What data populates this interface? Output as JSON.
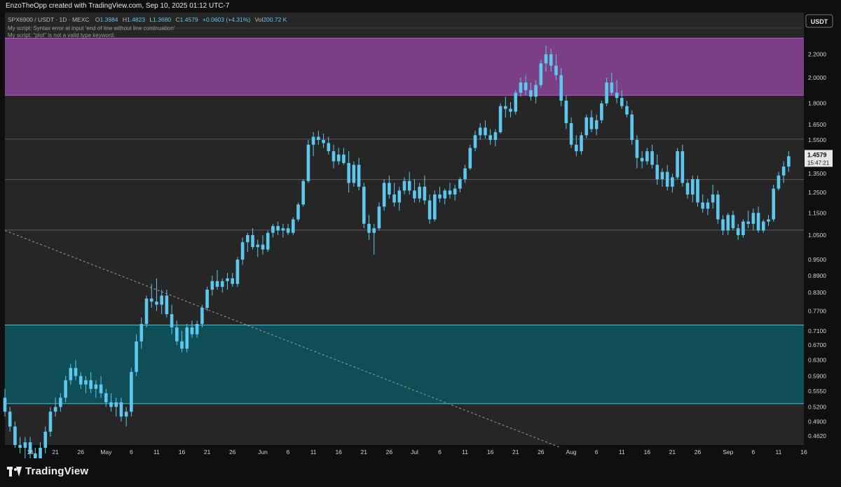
{
  "header": {
    "byline": "EnzoTheOpp created with TradingView.com, Sep 10, 2025 01:12 UTC-7"
  },
  "legend": {
    "symbol": "SPX6900 / USDT · 1D · MEXC",
    "open_label": "O",
    "open": "1.3984",
    "high_label": "H",
    "high": "1.4823",
    "low_label": "L",
    "low": "1.3680",
    "close_label": "C",
    "close": "1.4579",
    "change": "+0.0603 (+4.31%)",
    "vol_label": "Vol",
    "volume": "200.72 K",
    "error1": "My script: Syntax error at input 'end of line without line continuation'",
    "error2": "My script: \"plot\" is not a valid type keyword."
  },
  "footer": {
    "brand": "TradingView"
  },
  "colors": {
    "candle": "#5dc8ee",
    "supply_zone": "#7a3f85",
    "demand_zone": "#0f4d57",
    "grid_line": "#5a5a5a",
    "background": "#262626",
    "axis_bg": "#0f0f0f"
  },
  "chart_data": {
    "type": "candlestick",
    "currency": "USDT",
    "y_scale": "log",
    "ylim": [
      0.445,
      2.45
    ],
    "xlim": [
      "2025-04-11",
      "2025-09-16"
    ],
    "y_ticks": [
      "2.2000",
      "2.0000",
      "1.8000",
      "1.6500",
      "1.5500",
      "1.4500",
      "1.3500",
      "1.2500",
      "1.1500",
      "1.0500",
      "0.9500",
      "0.8900",
      "0.8300",
      "0.7700",
      "0.7100",
      "0.6700",
      "0.6300",
      "0.5900",
      "0.5550",
      "0.5200",
      "0.4900",
      "0.4620"
    ],
    "x_ticks": [
      {
        "date": "2025-04-16",
        "label": "16"
      },
      {
        "date": "2025-04-21",
        "label": "21"
      },
      {
        "date": "2025-04-26",
        "label": "26"
      },
      {
        "date": "2025-05-01",
        "label": "May"
      },
      {
        "date": "2025-05-06",
        "label": "6"
      },
      {
        "date": "2025-05-11",
        "label": "11"
      },
      {
        "date": "2025-05-16",
        "label": "16"
      },
      {
        "date": "2025-05-21",
        "label": "21"
      },
      {
        "date": "2025-05-26",
        "label": "26"
      },
      {
        "date": "2025-06-01",
        "label": "Jun"
      },
      {
        "date": "2025-06-06",
        "label": "6"
      },
      {
        "date": "2025-06-11",
        "label": "11"
      },
      {
        "date": "2025-06-16",
        "label": "16"
      },
      {
        "date": "2025-06-21",
        "label": "21"
      },
      {
        "date": "2025-06-26",
        "label": "26"
      },
      {
        "date": "2025-07-01",
        "label": "Jul"
      },
      {
        "date": "2025-07-06",
        "label": "6"
      },
      {
        "date": "2025-07-11",
        "label": "11"
      },
      {
        "date": "2025-07-16",
        "label": "16"
      },
      {
        "date": "2025-07-21",
        "label": "21"
      },
      {
        "date": "2025-07-26",
        "label": "26"
      },
      {
        "date": "2025-08-01",
        "label": "Aug"
      },
      {
        "date": "2025-08-06",
        "label": "6"
      },
      {
        "date": "2025-08-11",
        "label": "11"
      },
      {
        "date": "2025-08-16",
        "label": "16"
      },
      {
        "date": "2025-08-21",
        "label": "21"
      },
      {
        "date": "2025-08-26",
        "label": "26"
      },
      {
        "date": "2025-09-01",
        "label": "Sep"
      },
      {
        "date": "2025-09-06",
        "label": "6"
      },
      {
        "date": "2025-09-11",
        "label": "11"
      },
      {
        "date": "2025-09-16",
        "label": "16"
      }
    ],
    "last_price": "1.4579",
    "countdown": "15:47:21",
    "zones": [
      {
        "name": "supply",
        "low": 1.86,
        "high": 2.35
      },
      {
        "name": "demand",
        "low": 0.527,
        "high": 0.727
      }
    ],
    "levels": [
      1.555,
      1.318,
      1.072
    ],
    "trendline": [
      {
        "date": "2025-04-11",
        "price": 1.07
      },
      {
        "date": "2025-07-30",
        "price": 0.44
      }
    ],
    "start_date": "2025-04-11",
    "candles": [
      [
        0.54,
        0.56,
        0.5,
        0.51
      ],
      [
        0.51,
        0.52,
        0.47,
        0.48
      ],
      [
        0.48,
        0.49,
        0.44,
        0.445
      ],
      [
        0.445,
        0.46,
        0.43,
        0.44
      ],
      [
        0.44,
        0.46,
        0.42,
        0.45
      ],
      [
        0.45,
        0.46,
        0.42,
        0.43
      ],
      [
        0.43,
        0.44,
        0.41,
        0.42
      ],
      [
        0.42,
        0.45,
        0.41,
        0.44
      ],
      [
        0.44,
        0.48,
        0.43,
        0.47
      ],
      [
        0.47,
        0.52,
        0.46,
        0.51
      ],
      [
        0.51,
        0.54,
        0.5,
        0.52
      ],
      [
        0.52,
        0.55,
        0.51,
        0.54
      ],
      [
        0.54,
        0.59,
        0.53,
        0.58
      ],
      [
        0.58,
        0.62,
        0.57,
        0.61
      ],
      [
        0.61,
        0.63,
        0.58,
        0.59
      ],
      [
        0.59,
        0.6,
        0.56,
        0.57
      ],
      [
        0.57,
        0.59,
        0.55,
        0.58
      ],
      [
        0.58,
        0.6,
        0.55,
        0.56
      ],
      [
        0.56,
        0.58,
        0.54,
        0.57
      ],
      [
        0.57,
        0.59,
        0.54,
        0.55
      ],
      [
        0.55,
        0.56,
        0.52,
        0.53
      ],
      [
        0.53,
        0.55,
        0.51,
        0.52
      ],
      [
        0.52,
        0.54,
        0.5,
        0.53
      ],
      [
        0.53,
        0.54,
        0.49,
        0.5
      ],
      [
        0.5,
        0.52,
        0.48,
        0.51
      ],
      [
        0.51,
        0.61,
        0.5,
        0.6
      ],
      [
        0.6,
        0.7,
        0.59,
        0.68
      ],
      [
        0.68,
        0.75,
        0.66,
        0.73
      ],
      [
        0.73,
        0.82,
        0.72,
        0.81
      ],
      [
        0.81,
        0.86,
        0.78,
        0.8
      ],
      [
        0.8,
        0.88,
        0.77,
        0.79
      ],
      [
        0.79,
        0.84,
        0.76,
        0.82
      ],
      [
        0.82,
        0.84,
        0.75,
        0.76
      ],
      [
        0.76,
        0.79,
        0.7,
        0.72
      ],
      [
        0.72,
        0.74,
        0.67,
        0.68
      ],
      [
        0.68,
        0.71,
        0.65,
        0.66
      ],
      [
        0.66,
        0.73,
        0.65,
        0.72
      ],
      [
        0.72,
        0.74,
        0.69,
        0.7
      ],
      [
        0.7,
        0.74,
        0.69,
        0.73
      ],
      [
        0.73,
        0.79,
        0.72,
        0.78
      ],
      [
        0.78,
        0.85,
        0.77,
        0.84
      ],
      [
        0.84,
        0.89,
        0.82,
        0.87
      ],
      [
        0.87,
        0.91,
        0.84,
        0.85
      ],
      [
        0.85,
        0.88,
        0.83,
        0.87
      ],
      [
        0.87,
        0.9,
        0.84,
        0.88
      ],
      [
        0.88,
        0.9,
        0.85,
        0.86
      ],
      [
        0.86,
        0.96,
        0.85,
        0.95
      ],
      [
        0.95,
        1.04,
        0.93,
        1.02
      ],
      [
        1.02,
        1.06,
        0.98,
        1.05
      ],
      [
        1.05,
        1.08,
        0.99,
        1.0
      ],
      [
        1.0,
        1.03,
        0.96,
        1.01
      ],
      [
        1.01,
        1.05,
        0.97,
        0.99
      ],
      [
        0.99,
        1.07,
        0.98,
        1.06
      ],
      [
        1.06,
        1.1,
        1.04,
        1.09
      ],
      [
        1.09,
        1.11,
        1.05,
        1.07
      ],
      [
        1.07,
        1.1,
        1.04,
        1.08
      ],
      [
        1.08,
        1.1,
        1.05,
        1.06
      ],
      [
        1.06,
        1.13,
        1.05,
        1.12
      ],
      [
        1.12,
        1.2,
        1.11,
        1.19
      ],
      [
        1.19,
        1.32,
        1.18,
        1.31
      ],
      [
        1.31,
        1.55,
        1.3,
        1.52
      ],
      [
        1.52,
        1.6,
        1.45,
        1.57
      ],
      [
        1.57,
        1.61,
        1.52,
        1.55
      ],
      [
        1.55,
        1.59,
        1.5,
        1.53
      ],
      [
        1.53,
        1.57,
        1.46,
        1.48
      ],
      [
        1.48,
        1.52,
        1.38,
        1.42
      ],
      [
        1.42,
        1.5,
        1.4,
        1.46
      ],
      [
        1.46,
        1.5,
        1.4,
        1.41
      ],
      [
        1.41,
        1.48,
        1.25,
        1.3
      ],
      [
        1.3,
        1.42,
        1.28,
        1.4
      ],
      [
        1.4,
        1.44,
        1.26,
        1.28
      ],
      [
        1.28,
        1.3,
        1.08,
        1.1
      ],
      [
        1.1,
        1.14,
        1.03,
        1.06
      ],
      [
        1.06,
        1.1,
        0.97,
        1.08
      ],
      [
        1.08,
        1.2,
        1.07,
        1.18
      ],
      [
        1.18,
        1.32,
        1.16,
        1.3
      ],
      [
        1.3,
        1.34,
        1.22,
        1.24
      ],
      [
        1.24,
        1.3,
        1.18,
        1.2
      ],
      [
        1.2,
        1.28,
        1.16,
        1.26
      ],
      [
        1.26,
        1.33,
        1.24,
        1.31
      ],
      [
        1.31,
        1.36,
        1.24,
        1.26
      ],
      [
        1.26,
        1.32,
        1.2,
        1.22
      ],
      [
        1.22,
        1.3,
        1.2,
        1.28
      ],
      [
        1.28,
        1.34,
        1.19,
        1.21
      ],
      [
        1.21,
        1.24,
        1.1,
        1.12
      ],
      [
        1.12,
        1.26,
        1.11,
        1.24
      ],
      [
        1.24,
        1.28,
        1.2,
        1.22
      ],
      [
        1.22,
        1.27,
        1.19,
        1.26
      ],
      [
        1.26,
        1.3,
        1.22,
        1.24
      ],
      [
        1.24,
        1.29,
        1.21,
        1.27
      ],
      [
        1.27,
        1.33,
        1.25,
        1.32
      ],
      [
        1.32,
        1.4,
        1.3,
        1.38
      ],
      [
        1.38,
        1.52,
        1.37,
        1.5
      ],
      [
        1.5,
        1.61,
        1.48,
        1.58
      ],
      [
        1.58,
        1.66,
        1.55,
        1.63
      ],
      [
        1.63,
        1.68,
        1.56,
        1.58
      ],
      [
        1.58,
        1.62,
        1.52,
        1.55
      ],
      [
        1.55,
        1.62,
        1.51,
        1.6
      ],
      [
        1.6,
        1.8,
        1.59,
        1.78
      ],
      [
        1.78,
        1.85,
        1.7,
        1.76
      ],
      [
        1.76,
        1.81,
        1.7,
        1.74
      ],
      [
        1.74,
        1.9,
        1.72,
        1.88
      ],
      [
        1.88,
        2.0,
        1.85,
        1.96
      ],
      [
        1.96,
        2.02,
        1.86,
        1.9
      ],
      [
        1.9,
        1.96,
        1.82,
        1.85
      ],
      [
        1.85,
        1.98,
        1.8,
        1.94
      ],
      [
        1.94,
        2.15,
        1.92,
        2.12
      ],
      [
        2.12,
        2.28,
        2.05,
        2.2
      ],
      [
        2.2,
        2.25,
        2.05,
        2.1
      ],
      [
        2.1,
        2.2,
        1.98,
        2.02
      ],
      [
        2.02,
        2.08,
        1.78,
        1.82
      ],
      [
        1.82,
        1.86,
        1.62,
        1.66
      ],
      [
        1.66,
        1.7,
        1.5,
        1.52
      ],
      [
        1.52,
        1.58,
        1.45,
        1.48
      ],
      [
        1.48,
        1.6,
        1.46,
        1.58
      ],
      [
        1.58,
        1.72,
        1.56,
        1.7
      ],
      [
        1.7,
        1.75,
        1.6,
        1.62
      ],
      [
        1.62,
        1.72,
        1.58,
        1.68
      ],
      [
        1.68,
        1.82,
        1.66,
        1.8
      ],
      [
        1.8,
        2.0,
        1.78,
        1.96
      ],
      [
        1.96,
        2.04,
        1.86,
        1.88
      ],
      [
        1.88,
        1.98,
        1.8,
        1.84
      ],
      [
        1.84,
        1.9,
        1.76,
        1.78
      ],
      [
        1.78,
        1.82,
        1.7,
        1.72
      ],
      [
        1.72,
        1.75,
        1.52,
        1.55
      ],
      [
        1.55,
        1.58,
        1.38,
        1.44
      ],
      [
        1.44,
        1.48,
        1.38,
        1.42
      ],
      [
        1.42,
        1.5,
        1.4,
        1.48
      ],
      [
        1.48,
        1.52,
        1.38,
        1.4
      ],
      [
        1.4,
        1.46,
        1.29,
        1.32
      ],
      [
        1.32,
        1.38,
        1.28,
        1.36
      ],
      [
        1.36,
        1.4,
        1.26,
        1.28
      ],
      [
        1.28,
        1.35,
        1.25,
        1.33
      ],
      [
        1.33,
        1.5,
        1.32,
        1.48
      ],
      [
        1.48,
        1.52,
        1.28,
        1.3
      ],
      [
        1.3,
        1.32,
        1.22,
        1.24
      ],
      [
        1.24,
        1.34,
        1.2,
        1.32
      ],
      [
        1.32,
        1.34,
        1.18,
        1.2
      ],
      [
        1.2,
        1.24,
        1.15,
        1.17
      ],
      [
        1.17,
        1.22,
        1.14,
        1.2
      ],
      [
        1.2,
        1.29,
        1.17,
        1.24
      ],
      [
        1.24,
        1.26,
        1.1,
        1.12
      ],
      [
        1.12,
        1.14,
        1.05,
        1.07
      ],
      [
        1.07,
        1.15,
        1.05,
        1.14
      ],
      [
        1.14,
        1.16,
        1.07,
        1.08
      ],
      [
        1.08,
        1.1,
        1.03,
        1.05
      ],
      [
        1.05,
        1.12,
        1.04,
        1.11
      ],
      [
        1.11,
        1.16,
        1.08,
        1.1
      ],
      [
        1.1,
        1.17,
        1.07,
        1.15
      ],
      [
        1.15,
        1.18,
        1.06,
        1.07
      ],
      [
        1.07,
        1.12,
        1.06,
        1.11
      ],
      [
        1.11,
        1.14,
        1.09,
        1.12
      ],
      [
        1.12,
        1.29,
        1.11,
        1.27
      ],
      [
        1.27,
        1.36,
        1.26,
        1.34
      ],
      [
        1.34,
        1.42,
        1.3,
        1.39
      ],
      [
        1.39,
        1.48,
        1.36,
        1.45
      ]
    ]
  }
}
